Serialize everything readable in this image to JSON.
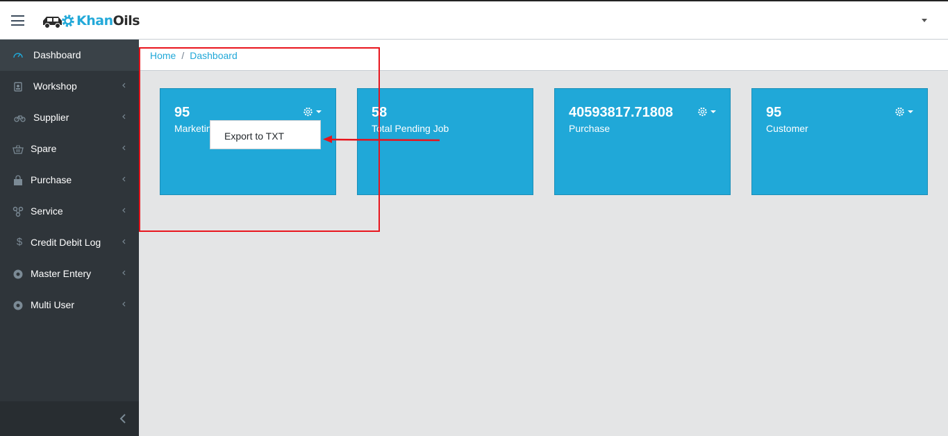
{
  "header": {
    "logo_khan": "Khan",
    "logo_oils": "Oils"
  },
  "sidebar": {
    "items": [
      {
        "label": "Dashboard",
        "icon": "speedometer-icon",
        "active": true
      },
      {
        "label": "Workshop",
        "icon": "badge-icon"
      },
      {
        "label": "Supplier",
        "icon": "bicycle-icon"
      },
      {
        "label": "Spare",
        "icon": "basket-icon"
      },
      {
        "label": "Purchase",
        "icon": "bag-icon"
      },
      {
        "label": "Service",
        "icon": "link-icon"
      },
      {
        "label": "Credit Debit Log",
        "icon": "dollar-icon"
      },
      {
        "label": "Master Entery",
        "icon": "circle-icon"
      },
      {
        "label": "Multi User",
        "icon": "circle-icon"
      }
    ]
  },
  "breadcrumb": {
    "home": "Home",
    "separator": "/",
    "current": "Dashboard"
  },
  "cards": [
    {
      "value": "95",
      "label": "Marketing"
    },
    {
      "value": "58",
      "label": "Total Pending Job"
    },
    {
      "value": "40593817.71808",
      "label": "Purchase"
    },
    {
      "value": "95",
      "label": "Customer"
    }
  ],
  "dropdown": {
    "item": "Export to TXT"
  },
  "colors": {
    "accent": "#20a8d8",
    "sidebar_bg": "#2f353a",
    "annotation": "#e8141c"
  }
}
